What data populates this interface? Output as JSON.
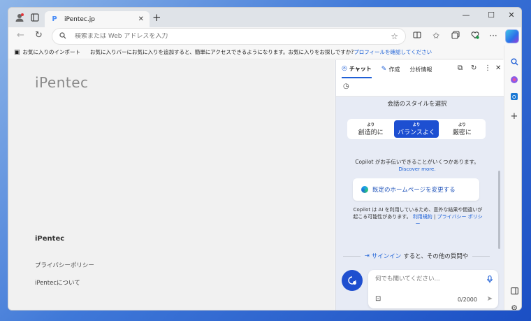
{
  "tab": {
    "favicon": "P",
    "title": "iPentec.jp"
  },
  "address": {
    "placeholder": "検索または Web アドレスを入力"
  },
  "favorites": {
    "import_label": "お気に入りのインポート",
    "hint": "お気に入りバーにお気に入りを追加すると、簡単にアクセスできるようになります。お気に入りをお探しですか?",
    "profile_link": "プロフィールを確認してください"
  },
  "page": {
    "logo": "iPentec",
    "footer_title": "iPentec",
    "footer_links": [
      "プライバシーポリシー",
      "iPentecについて"
    ]
  },
  "copilot": {
    "tabs": {
      "chat": "チャット",
      "compose": "作成",
      "insights": "分析情報"
    },
    "style_title": "会話のスタイルを選択",
    "styles": [
      {
        "small": "より",
        "label": "創造的に",
        "active": false
      },
      {
        "small": "より",
        "label": "バランスよく",
        "active": true
      },
      {
        "small": "より",
        "label": "厳密に",
        "active": false
      }
    ],
    "help_text": "Copilot がお手伝いできることがいくつかあります。",
    "discover": "Discover more.",
    "card": "既定のホームページを変更する",
    "disclaimer_pre": "Copilot は AI を利用しているため、意外な結果や間違いが起こる可能性があります。",
    "terms": "利用規約",
    "divider": "|",
    "privacy": "プライバシー ポリシー",
    "signin_link": "サインイン",
    "signin_rest": "すると、その他の質問や",
    "input_placeholder": "何でも聞いてください...",
    "char_count": "0/2000"
  },
  "colors": {
    "accent": "#1d4fd1",
    "link": "#1a5fd6"
  }
}
